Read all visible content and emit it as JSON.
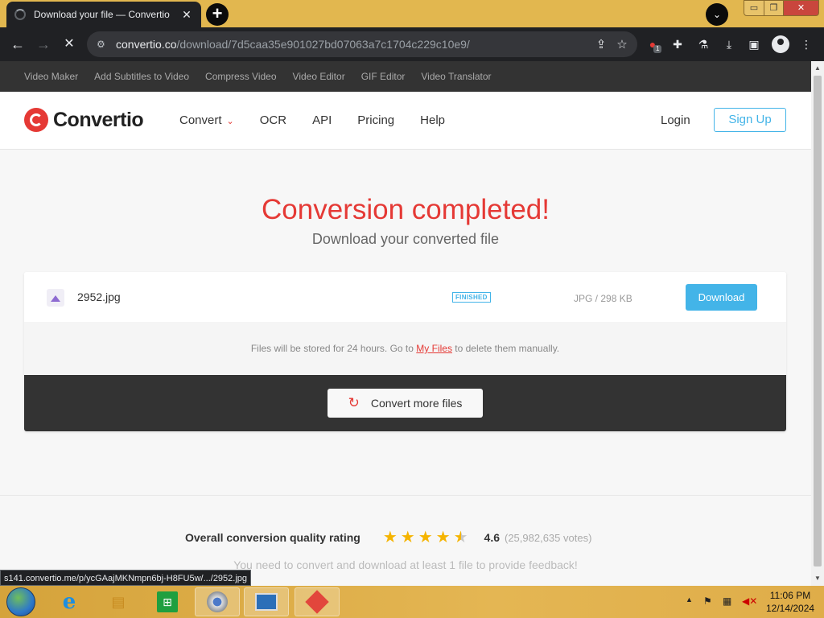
{
  "browser": {
    "tab_title": "Download your file — Convertio",
    "tab_close": "✕",
    "new_tab": "+",
    "tab_search": "⌄",
    "window_controls": {
      "minimize": "▭",
      "maximize": "❐",
      "close": "✕"
    },
    "url_host": "convertio.co",
    "url_path": "/download/7d5caa35e901027bd07063a7c1704c229c10e9/",
    "extension_badge": "1"
  },
  "site": {
    "top_links": [
      "Video Maker",
      "Add Subtitles to Video",
      "Compress Video",
      "Video Editor",
      "GIF Editor",
      "Video Translator"
    ],
    "logo_text": "Convertio",
    "nav": {
      "convert": "Convert",
      "ocr": "OCR",
      "api": "API",
      "pricing": "Pricing",
      "help": "Help"
    },
    "login": "Login",
    "signup": "Sign Up"
  },
  "result": {
    "title": "Conversion completed!",
    "subtitle": "Download your converted file",
    "file": {
      "name": "2952.jpg",
      "status": "FINISHED",
      "size": "JPG / 298 KB",
      "download_label": "Download"
    },
    "storage_note_before": "Files will be stored for 24 hours. Go to ",
    "storage_link": "My Files",
    "storage_note_after": " to delete them manually.",
    "convert_more": "Convert more files"
  },
  "rating": {
    "label": "Overall conversion quality rating",
    "stars_value": 4.6,
    "value": "4.6",
    "votes": "(25,982,635 votes)",
    "feedback_note": "You need to convert and download at least 1 file to provide feedback!"
  },
  "status_bar_url": "s141.convertio.me/p/ycGAajMKNmpn6bj-H8FU5w/.../2952.jpg",
  "taskbar": {
    "time": "11:06 PM",
    "date": "12/14/2024"
  },
  "colors": {
    "brand_red": "#e53935",
    "accent_blue": "#43b4e8",
    "star": "#f5b400"
  },
  "icons": [
    "loading-spinner-icon",
    "back-icon",
    "forward-icon",
    "stop-icon",
    "site-info-icon",
    "share-icon",
    "star-icon",
    "extension-icon",
    "puzzle-icon",
    "lab-icon",
    "download-icon",
    "sidebar-icon",
    "profile-icon",
    "menu-icon",
    "image-file-icon",
    "refresh-icon"
  ]
}
